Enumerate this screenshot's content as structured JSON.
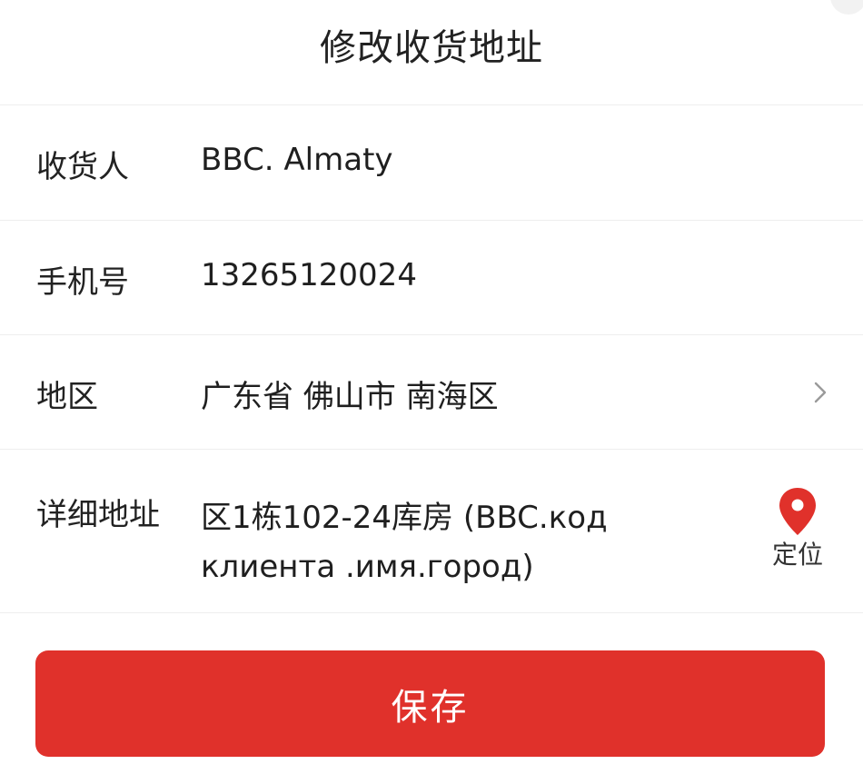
{
  "header": {
    "title": "修改收货地址"
  },
  "form": {
    "consignee": {
      "label": "收货人",
      "value": "BBC. Almaty"
    },
    "phone": {
      "label": "手机号",
      "value": "13265120024"
    },
    "region": {
      "label": "地区",
      "value": "广东省 佛山市 南海区",
      "chevron_icon": "chevron-right-icon"
    },
    "address": {
      "label": "详细地址",
      "value": "区1栋102-24库房 (BBC.код клиента .имя.город)",
      "locate_label": "定位",
      "locate_icon": "map-pin-icon"
    }
  },
  "actions": {
    "save_label": "保存"
  },
  "colors": {
    "accent": "#e0312b",
    "divider": "#eeeeee",
    "text": "#1f1f1f"
  }
}
